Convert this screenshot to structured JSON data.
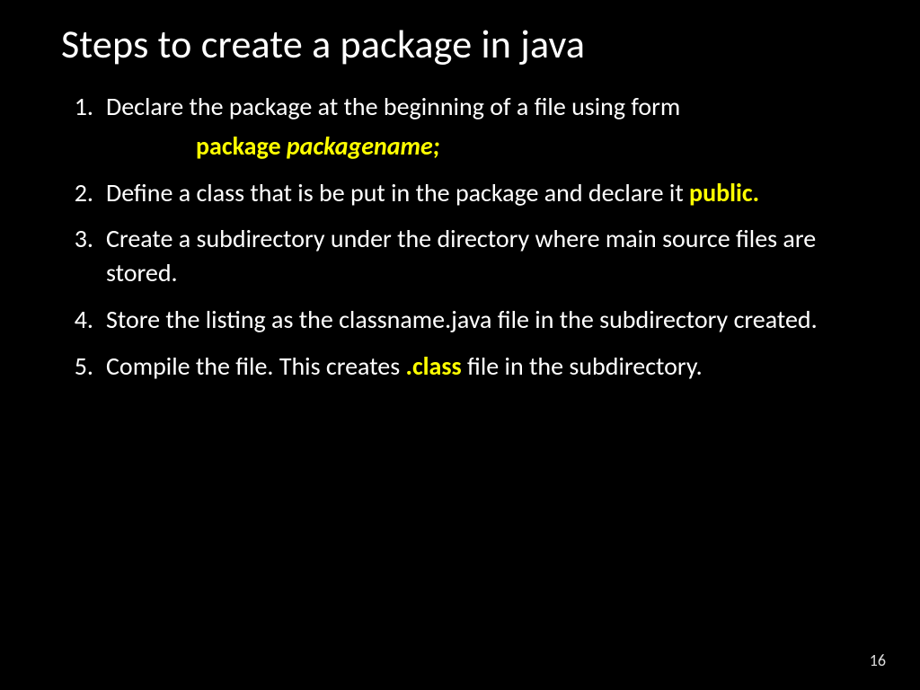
{
  "title": "Steps to create a package in java",
  "code_line": {
    "kw": "package ",
    "ident": "packagename",
    "tail": ";"
  },
  "steps": {
    "s1": "Declare the package at the beginning of a file using form",
    "s2_a": "Define a class that is be put in the package and declare it ",
    "s2_hl": "public.",
    "s3": "Create a subdirectory under the directory where main source files are stored.",
    "s4": "Store the listing as the classname.java file in the subdirectory created.",
    "s5_a": "Compile the file. This creates ",
    "s5_hl": ".class",
    "s5_b": " file in the subdirectory."
  },
  "page_number": "16"
}
